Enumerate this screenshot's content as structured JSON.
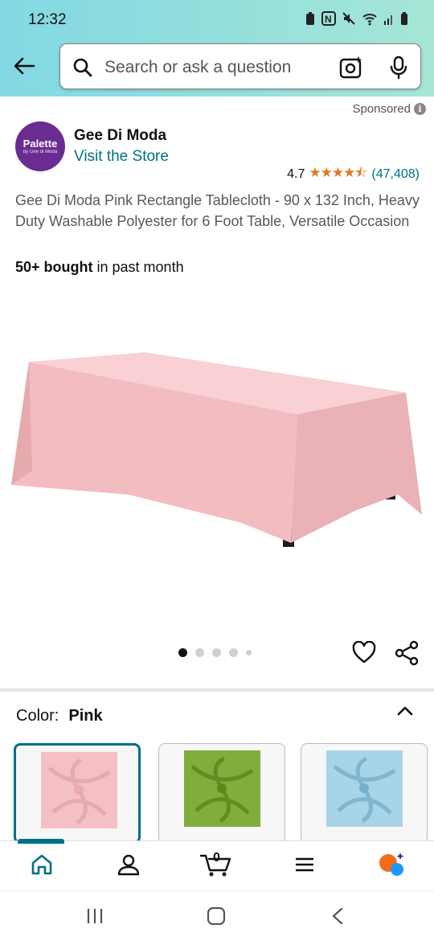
{
  "status": {
    "time": "12:32"
  },
  "search": {
    "placeholder": "Search or ask a question"
  },
  "ad": {
    "sponsored_label": "Sponsored",
    "info_glyph": "i"
  },
  "store": {
    "logo_text": "Palette",
    "logo_subtext": "by Gee di Moda",
    "name": "Gee Di Moda",
    "visit_label": "Visit the Store"
  },
  "rating": {
    "value": "4.7",
    "stars_glyph": "★★★★⯪",
    "count": "(47,408)",
    "stars": 4.7
  },
  "product": {
    "title": "Gee Di Moda Pink Rectangle Tablecloth - 90 x 132 Inch, Heavy Duty Washable Polyester for 6 Foot Table, Versatile Occasion",
    "bought_bold": "50+ bought",
    "bought_rest": " in past month",
    "image_count": 5,
    "active_image": 1
  },
  "color": {
    "label": "Color:",
    "selected": "Pink",
    "swatches": [
      {
        "name": "Pink",
        "hex": "#f4c0c6"
      },
      {
        "name": "Green",
        "hex": "#7fae3a"
      },
      {
        "name": "Light Blue",
        "hex": "#a8d4e8"
      }
    ]
  },
  "cart": {
    "count": "0"
  },
  "colors": {
    "link": "#007185",
    "star": "#de7921",
    "accent": "#007185",
    "header": "#82d8e3",
    "tablecloth": "#f2bcc1"
  }
}
